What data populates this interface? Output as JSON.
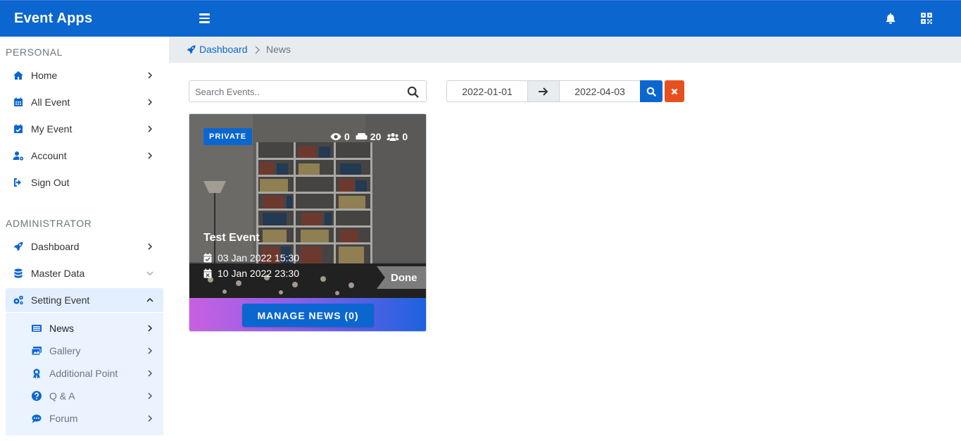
{
  "app": {
    "title": "Event Apps"
  },
  "sidebar": {
    "personal_title": "PERSONAL",
    "personal_items": [
      {
        "label": "Home",
        "icon": "home-icon"
      },
      {
        "label": "All Event",
        "icon": "calendar-grid-icon"
      },
      {
        "label": "My Event",
        "icon": "calendar-check-icon"
      },
      {
        "label": "Account",
        "icon": "user-cog-icon"
      },
      {
        "label": "Sign Out",
        "icon": "sign-out-icon"
      }
    ],
    "admin_title": "ADMINISTRATOR",
    "admin_items": [
      {
        "label": "Dashboard",
        "icon": "rocket-icon"
      },
      {
        "label": "Master Data",
        "icon": "database-icon"
      },
      {
        "label": "Setting Event",
        "icon": "cogs-icon"
      }
    ],
    "sub_items": [
      {
        "label": "News",
        "icon": "news-icon"
      },
      {
        "label": "Gallery",
        "icon": "images-icon"
      },
      {
        "label": "Additional Point",
        "icon": "award-icon"
      },
      {
        "label": "Q & A",
        "icon": "question-circle-icon"
      },
      {
        "label": "Forum",
        "icon": "comment-icon"
      }
    ]
  },
  "breadcrumb": {
    "home": "Dashboard",
    "current": "News"
  },
  "search": {
    "placeholder": "Search Events.."
  },
  "date_range": {
    "from": "2022-01-01",
    "to": "2022-04-03"
  },
  "card": {
    "badge": "PRIVATE",
    "views": "0",
    "seats": "20",
    "participants": "0",
    "title": "Test Event",
    "start": "03 Jan 2022 15:30",
    "end": "10 Jan 2022 23:30",
    "status": "Done",
    "action": "MANAGE NEWS (0)"
  },
  "colors": {
    "primary": "#0b66d0",
    "danger": "#e6501f"
  }
}
